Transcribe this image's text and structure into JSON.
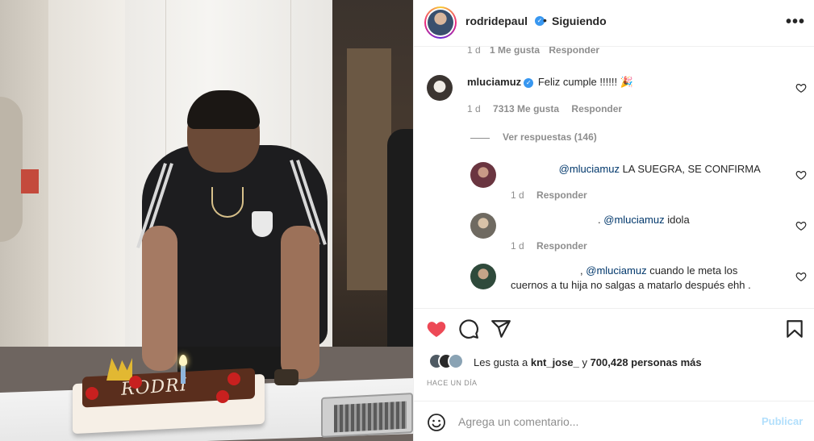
{
  "header": {
    "username": "rodridepaul",
    "separator": "•",
    "follow_status": "Siguiendo",
    "more_icon": "more-horizontal-icon"
  },
  "comments": {
    "previous_meta": {
      "time": "1 d",
      "likes": "1 Me gusta",
      "reply": "Responder"
    },
    "items": [
      {
        "username": "mluciamuz",
        "verified": true,
        "text": "Feliz cumple !!!!!! 🎉",
        "time": "1 d",
        "likes": "7313 Me gusta",
        "reply": "Responder"
      }
    ],
    "view_replies": "Ver respuestas (146)",
    "replies": [
      {
        "mention": "@mluciamuz",
        "text": "LA SUEGRA, SE CONFIRMA",
        "time": "1 d",
        "reply": "Responder"
      },
      {
        "prefix": ".",
        "mention": "@mluciamuz",
        "text": "idola",
        "time": "1 d",
        "reply": "Responder"
      },
      {
        "prefix": ",",
        "mention": "@mluciamuz",
        "text": "cuando le meta los",
        "text_line2": "cuernos a tu hija no salgas a matarlo después ehh ."
      }
    ]
  },
  "actions": {
    "icons": [
      "heart-filled-icon",
      "comment-icon",
      "share-icon",
      "bookmark-icon"
    ],
    "liked_color": "#ed4956",
    "likes_prefix": "Les gusta a",
    "likes_user": "knt_jose_",
    "likes_mid": "y",
    "likes_count": "700,428 personas más",
    "time_ago": "HACE UN DÍA"
  },
  "composer": {
    "placeholder": "Agrega un comentario...",
    "publish_label": "Publicar",
    "publish_color": "#b2dffc"
  },
  "photo": {
    "cake_text": "RODRI"
  }
}
